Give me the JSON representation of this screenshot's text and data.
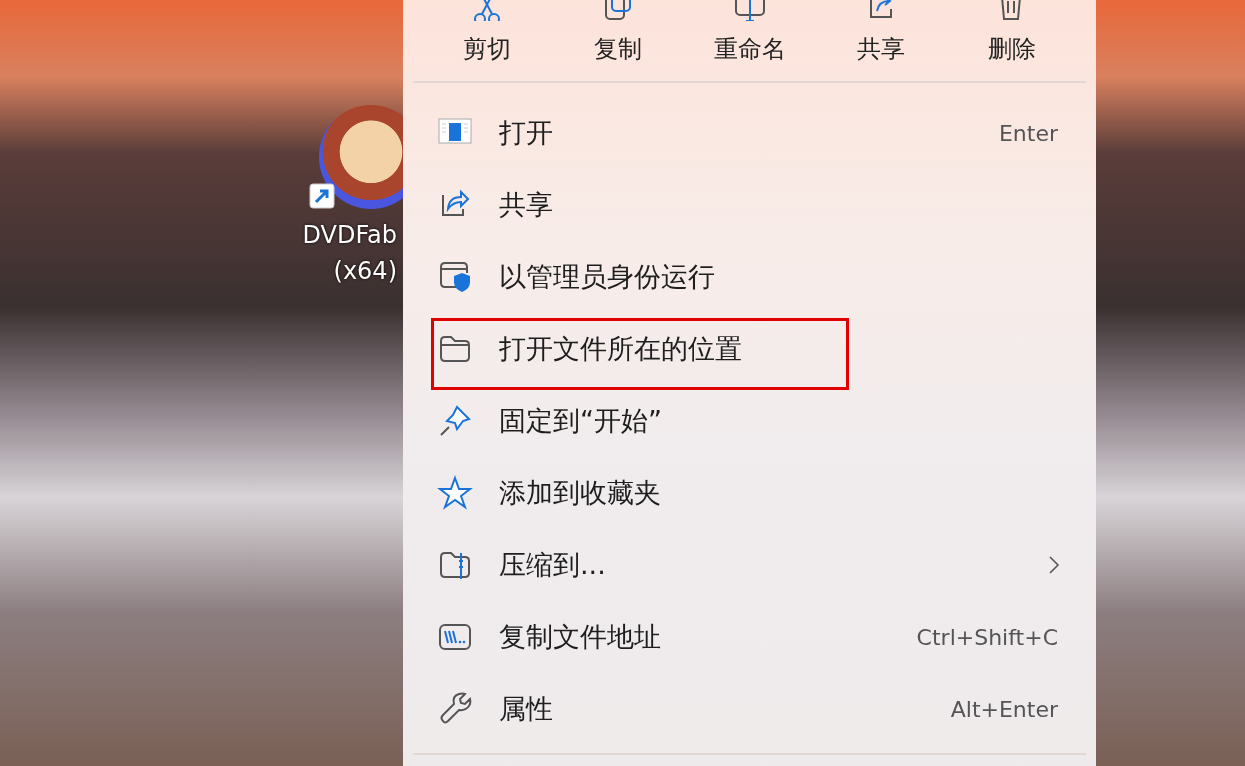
{
  "desktop": {
    "shortcut": {
      "label": "DVDFab (x64)"
    }
  },
  "context_menu": {
    "toolbar": [
      {
        "label": "剪切"
      },
      {
        "label": "复制"
      },
      {
        "label": "重命名"
      },
      {
        "label": "共享"
      },
      {
        "label": "删除"
      }
    ],
    "items": [
      {
        "label": "打开",
        "shortcut": "Enter",
        "submenu": false,
        "highlighted": false
      },
      {
        "label": "共享",
        "submenu": false,
        "highlighted": false
      },
      {
        "label": "以管理员身份运行",
        "submenu": false,
        "highlighted": false
      },
      {
        "label": "打开文件所在的位置",
        "submenu": false,
        "highlighted": true
      },
      {
        "label": "固定到“开始”",
        "submenu": false,
        "highlighted": false
      },
      {
        "label": "添加到收藏夹",
        "submenu": false,
        "highlighted": false
      },
      {
        "label": "压缩到...",
        "submenu": true,
        "highlighted": false
      },
      {
        "label": "复制文件地址",
        "shortcut": "Ctrl+Shift+C",
        "submenu": false,
        "highlighted": false
      },
      {
        "label": "属性",
        "shortcut": "Alt+Enter",
        "submenu": false,
        "highlighted": false
      }
    ]
  }
}
